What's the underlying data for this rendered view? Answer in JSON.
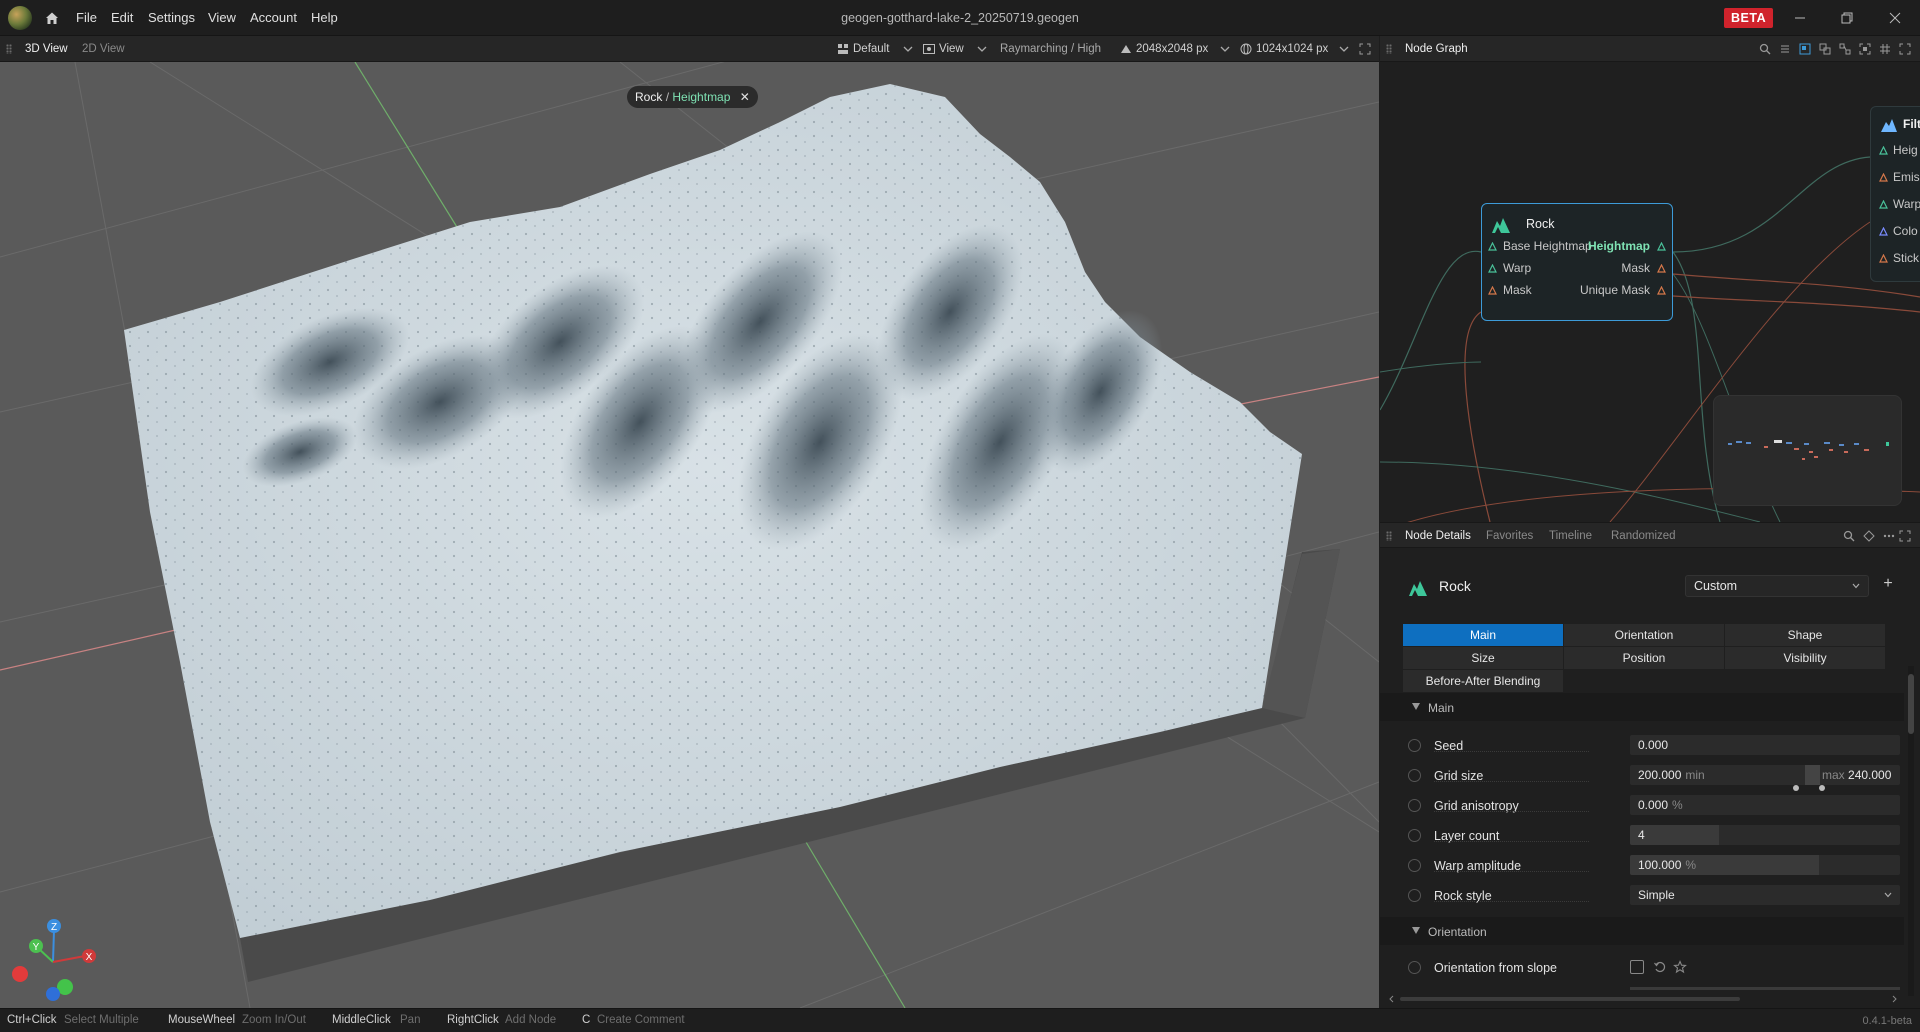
{
  "titlebar": {
    "menu": [
      "File",
      "Edit",
      "Settings",
      "View",
      "Account",
      "Help"
    ],
    "window_title": "geogen-gotthard-lake-2_20250719.geogen",
    "beta_label": "BETA"
  },
  "viewport_toolbar": {
    "tabs": [
      "3D View",
      "2D View"
    ],
    "active_tab": "3D View",
    "layout_preset": "Default",
    "view_menu": "View",
    "render_mode": "Raymarching / High",
    "resolution": "2048x2048 px",
    "preview_resolution": "1024x1024 px"
  },
  "viewport": {
    "chip_node": "Rock",
    "chip_sep": "/",
    "chip_output": "Heightmap",
    "chip_close": "✕",
    "gizmo_axes": [
      "Z",
      "Y",
      "X"
    ]
  },
  "node_graph": {
    "title": "Node Graph",
    "rock_node": {
      "title": "Rock",
      "inputs": [
        "Base Heightmap",
        "Warp",
        "Mask"
      ],
      "outputs": [
        "Heightmap",
        "Mask",
        "Unique Mask"
      ]
    },
    "filter_node": {
      "title": "Filt",
      "inputs": [
        "Heig",
        "Emis",
        "Warp",
        "Colo",
        "Stick"
      ]
    }
  },
  "details_toolbar": {
    "tabs": [
      "Node Details",
      "Favorites",
      "Timeline",
      "Randomized"
    ],
    "active_tab": "Node Details"
  },
  "details": {
    "node_name": "Rock",
    "preset": "Custom",
    "add_label": "+",
    "segments": [
      "Main",
      "Orientation",
      "Shape",
      "Size",
      "Position",
      "Visibility",
      "Before-After Blending"
    ],
    "active_segment": "Main",
    "section_main": "Main",
    "section_orientation": "Orientation",
    "params": {
      "seed": {
        "label": "Seed",
        "value": "0.000"
      },
      "grid_size": {
        "label": "Grid size",
        "min_value": "200.000",
        "min_label": "min",
        "max_label": "max",
        "max_value": "240.000"
      },
      "grid_anisotropy": {
        "label": "Grid anisotropy",
        "value": "0.000",
        "unit": "%"
      },
      "layer_count": {
        "label": "Layer count",
        "value": "4",
        "fill_fraction": 0.33
      },
      "warp_amplitude": {
        "label": "Warp amplitude",
        "value": "100.000",
        "unit": "%",
        "fill_fraction": 0.7
      },
      "rock_style": {
        "label": "Rock style",
        "value": "Simple"
      },
      "orientation_from_slope": {
        "label": "Orientation from slope",
        "checked": false
      }
    }
  },
  "statusbar": {
    "hints": [
      {
        "key": "Ctrl+Click",
        "desc": "Select Multiple"
      },
      {
        "key": "MouseWheel",
        "desc": "Zoom In/Out"
      },
      {
        "key": "MiddleClick",
        "desc": "Pan"
      },
      {
        "key": "RightClick",
        "desc": "Add Node"
      },
      {
        "key": "C",
        "desc": "Create Comment"
      }
    ],
    "version": "0.4.1-beta"
  },
  "colors": {
    "accent_blue": "#0e6fc0",
    "beta_red": "#d0232c",
    "heightmap_green": "#7fe3b4",
    "node_border": "#3d9bd8"
  }
}
